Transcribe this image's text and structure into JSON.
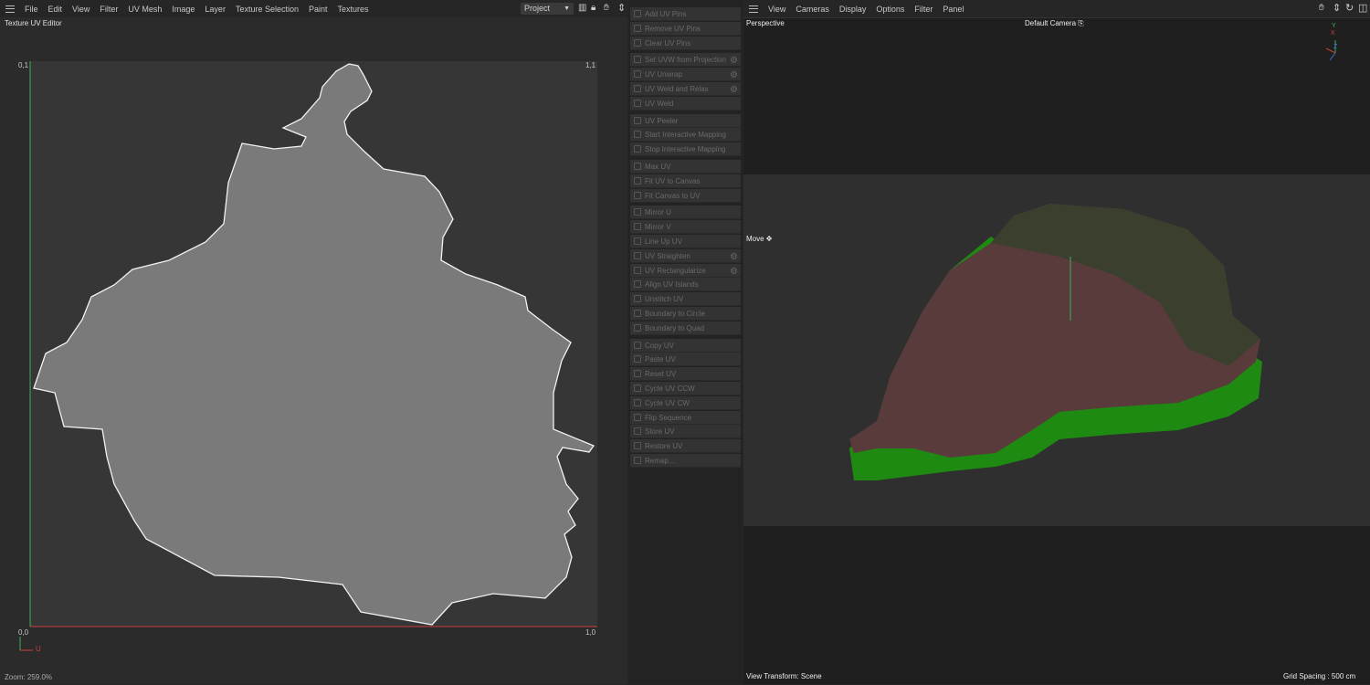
{
  "uv_editor": {
    "menu": [
      "File",
      "Edit",
      "View",
      "Filter",
      "UV Mesh",
      "Image",
      "Layer",
      "Texture Selection",
      "Paint",
      "Textures"
    ],
    "project_select": "Project",
    "title": "Texture UV Editor",
    "corners": {
      "top_left": "0,1",
      "top_right": "1,1",
      "bottom_left": "0,0",
      "bottom_right": "1,0"
    },
    "axis_u": "U",
    "zoom": "Zoom: 259.0%"
  },
  "commands": [
    {
      "group": [
        {
          "label": "Add UV Pins"
        },
        {
          "label": "Remove UV Pins"
        },
        {
          "label": "Clear UV Pins"
        }
      ]
    },
    {
      "group": [
        {
          "label": "Set UVW from Projection",
          "gear": true
        },
        {
          "label": "UV Unwrap",
          "gear": true
        },
        {
          "label": "UV Weld and Relax",
          "gear": true
        },
        {
          "label": "UV Weld"
        }
      ]
    },
    {
      "group": [
        {
          "label": "UV Peeler"
        },
        {
          "label": "Start Interactive Mapping"
        },
        {
          "label": "Stop Interactive Mapping"
        }
      ]
    },
    {
      "group": [
        {
          "label": "Max UV"
        },
        {
          "label": "Fit UV to Canvas"
        },
        {
          "label": "Fit Canvas to UV"
        }
      ]
    },
    {
      "group": [
        {
          "label": "Mirror U"
        },
        {
          "label": "Mirror V"
        },
        {
          "label": "Line Up UV"
        },
        {
          "label": "UV Straighten",
          "gear": true
        },
        {
          "label": "UV Rectangularize",
          "gear": true
        },
        {
          "label": "Align UV Islands"
        },
        {
          "label": "Unstitch UV"
        },
        {
          "label": "Boundary to Circle"
        },
        {
          "label": "Boundary to Quad"
        }
      ]
    },
    {
      "group": [
        {
          "label": "Copy UV"
        },
        {
          "label": "Paste UV"
        },
        {
          "label": "Reset UV"
        },
        {
          "label": "Cycle UV CCW"
        },
        {
          "label": "Cycle UV CW"
        },
        {
          "label": "Flip Sequence"
        },
        {
          "label": "Store UV"
        },
        {
          "label": "Restore UV"
        },
        {
          "label": "Remap..."
        }
      ]
    }
  ],
  "viewport": {
    "menu": [
      "View",
      "Cameras",
      "Display",
      "Options",
      "Filter",
      "Panel"
    ],
    "view_name": "Perspective",
    "camera": "Default Camera",
    "tool": "Move",
    "view_transform": "View Transform: Scene",
    "grid_spacing": "Grid Spacing : 500 cm",
    "axes": {
      "x": "X",
      "y": "Y",
      "z": "Z"
    }
  },
  "colors": {
    "extrusion": "#1e8a12",
    "u_axis": "#c84040",
    "v_axis": "#3fae5a"
  }
}
